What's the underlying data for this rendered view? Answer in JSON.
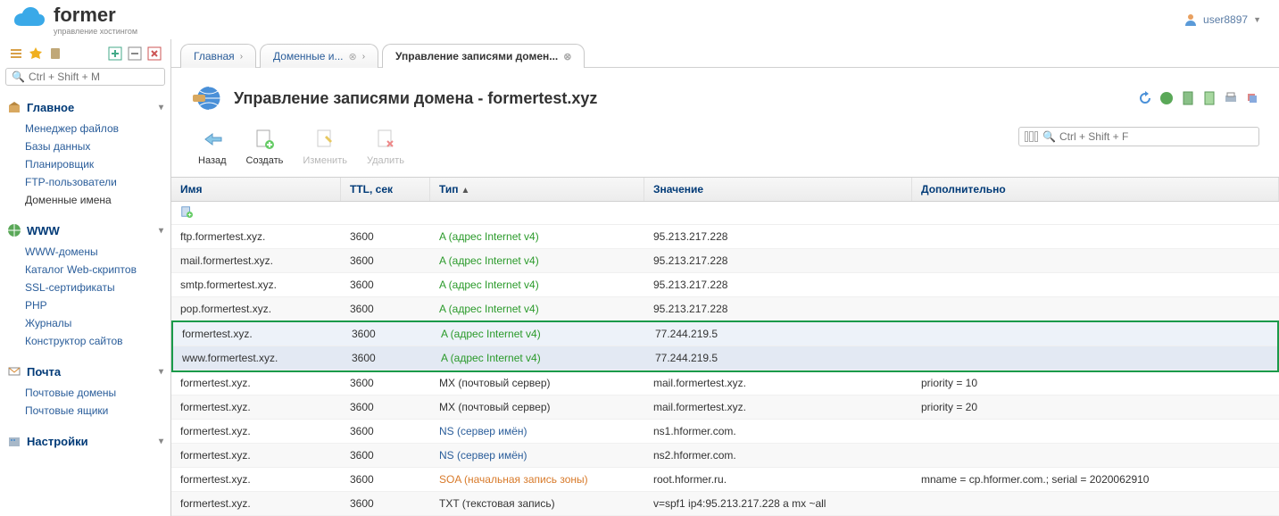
{
  "brand": {
    "title": "former",
    "subtitle": "управление хостингом"
  },
  "user": {
    "name": "user8897"
  },
  "sidebar": {
    "search_placeholder": "Ctrl + Shift + M",
    "sections": [
      {
        "title": "Главное",
        "items": [
          {
            "label": "Менеджер файлов"
          },
          {
            "label": "Базы данных"
          },
          {
            "label": "Планировщик"
          },
          {
            "label": "FTP-пользователи"
          },
          {
            "label": "Доменные имена",
            "plain": true
          }
        ]
      },
      {
        "title": "WWW",
        "items": [
          {
            "label": "WWW-домены"
          },
          {
            "label": "Каталог Web-скриптов"
          },
          {
            "label": "SSL-сертификаты"
          },
          {
            "label": "PHP"
          },
          {
            "label": "Журналы"
          },
          {
            "label": "Конструктор сайтов"
          }
        ]
      },
      {
        "title": "Почта",
        "items": [
          {
            "label": "Почтовые домены"
          },
          {
            "label": "Почтовые ящики"
          }
        ]
      },
      {
        "title": "Настройки",
        "items": []
      }
    ]
  },
  "tabs": [
    {
      "label": "Главная",
      "closable": false,
      "active": false
    },
    {
      "label": "Доменные и...",
      "closable": true,
      "active": false
    },
    {
      "label": "Управление записями домен...",
      "closable": true,
      "active": true
    }
  ],
  "page": {
    "title": "Управление записями домена - formertest.xyz",
    "filter_placeholder": "Ctrl + Shift + F",
    "toolbar": [
      {
        "label": "Назад",
        "disabled": false,
        "icon": "back"
      },
      {
        "label": "Создать",
        "disabled": false,
        "icon": "create"
      },
      {
        "label": "Изменить",
        "disabled": true,
        "icon": "edit"
      },
      {
        "label": "Удалить",
        "disabled": true,
        "icon": "delete"
      }
    ],
    "columns": {
      "name": "Имя",
      "ttl": "TTL, сек",
      "type": "Тип",
      "value": "Значение",
      "extra": "Дополнительно"
    },
    "rows": [
      {
        "name": "ftp.formertest.xyz.",
        "ttl": "3600",
        "type": "A (адрес Internet v4)",
        "type_class": "t-a",
        "value": "95.213.217.228",
        "extra": ""
      },
      {
        "name": "mail.formertest.xyz.",
        "ttl": "3600",
        "type": "A (адрес Internet v4)",
        "type_class": "t-a",
        "value": "95.213.217.228",
        "extra": ""
      },
      {
        "name": "smtp.formertest.xyz.",
        "ttl": "3600",
        "type": "A (адрес Internet v4)",
        "type_class": "t-a",
        "value": "95.213.217.228",
        "extra": ""
      },
      {
        "name": "pop.formertest.xyz.",
        "ttl": "3600",
        "type": "A (адрес Internet v4)",
        "type_class": "t-a",
        "value": "95.213.217.228",
        "extra": ""
      },
      {
        "name": "formertest.xyz.",
        "ttl": "3600",
        "type": "A (адрес Internet v4)",
        "type_class": "t-a",
        "value": "77.244.219.5",
        "extra": "",
        "hl": true
      },
      {
        "name": "www.formertest.xyz.",
        "ttl": "3600",
        "type": "A (адрес Internet v4)",
        "type_class": "t-a",
        "value": "77.244.219.5",
        "extra": "",
        "hl": true
      },
      {
        "name": "formertest.xyz.",
        "ttl": "3600",
        "type": "MX (почтовый сервер)",
        "type_class": "",
        "value": "mail.formertest.xyz.",
        "extra": "priority = 10"
      },
      {
        "name": "formertest.xyz.",
        "ttl": "3600",
        "type": "MX (почтовый сервер)",
        "type_class": "",
        "value": "mail.formertest.xyz.",
        "extra": "priority = 20"
      },
      {
        "name": "formertest.xyz.",
        "ttl": "3600",
        "type": "NS (сервер имён)",
        "type_class": "t-ns",
        "value": "ns1.hformer.com.",
        "extra": ""
      },
      {
        "name": "formertest.xyz.",
        "ttl": "3600",
        "type": "NS (сервер имён)",
        "type_class": "t-ns",
        "value": "ns2.hformer.com.",
        "extra": ""
      },
      {
        "name": "formertest.xyz.",
        "ttl": "3600",
        "type": "SOA (начальная запись зоны)",
        "type_class": "t-soa",
        "value": "root.hformer.ru.",
        "extra": "mname = cp.hformer.com.; serial = 2020062910"
      },
      {
        "name": "formertest.xyz.",
        "ttl": "3600",
        "type": "TXT (текстовая запись)",
        "type_class": "",
        "value": "v=spf1 ip4:95.213.217.228 a mx ~all",
        "extra": ""
      }
    ]
  }
}
